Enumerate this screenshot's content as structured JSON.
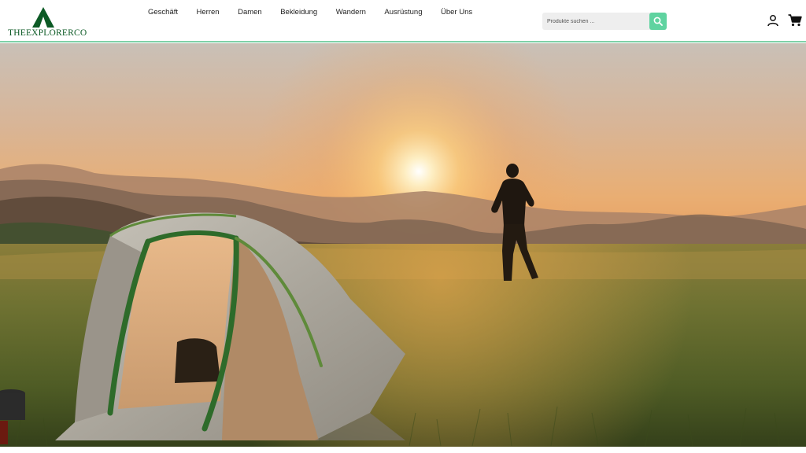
{
  "brand": {
    "name": "THEEXPLORERCO",
    "logo_icon": "tent-logo-icon",
    "color": "#0c5a25"
  },
  "nav": {
    "items": [
      {
        "label": "Geschäft"
      },
      {
        "label": "Herren"
      },
      {
        "label": "Damen"
      },
      {
        "label": "Bekleidung"
      },
      {
        "label": "Wandern"
      },
      {
        "label": "Ausrüstung"
      },
      {
        "label": "Über Uns"
      }
    ]
  },
  "search": {
    "placeholder": "Produkte suchen ...",
    "value": "",
    "icon": "search-icon",
    "button_color": "#5fd3a0"
  },
  "header_actions": {
    "account_icon": "user-icon",
    "cart_icon": "cart-icon"
  },
  "hero": {
    "image": "hiker-at-sunrise-with-tent",
    "accent_border": "#7fd1a8"
  }
}
